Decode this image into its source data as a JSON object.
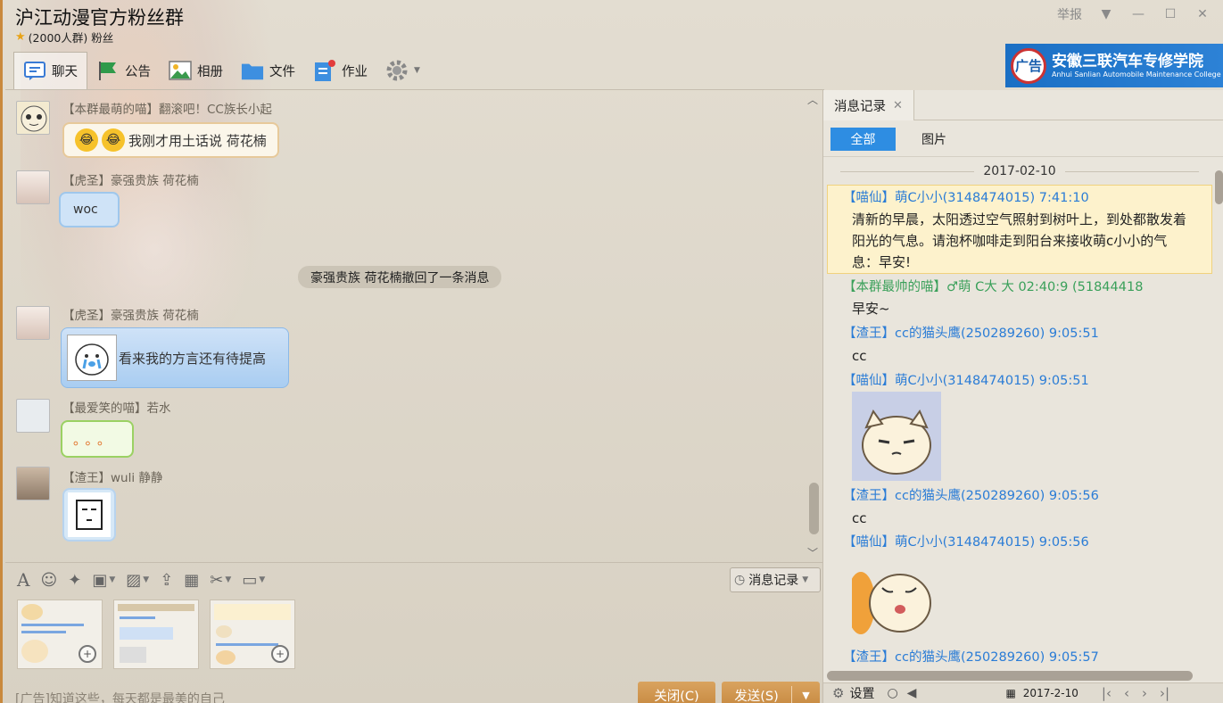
{
  "window": {
    "title": "沪江动漫官方粉丝群",
    "subtitle": "(2000人群) 粉丝",
    "report_label": "举报"
  },
  "ad_banner": {
    "logo_text": "广告",
    "main": "安徽三联汽车专修学院",
    "sub": "Anhui Sanlian Automobile Maintenance College"
  },
  "tabs": [
    {
      "label": "聊天",
      "icon": "chat-icon"
    },
    {
      "label": "公告",
      "icon": "announcement-flag-icon"
    },
    {
      "label": "相册",
      "icon": "photo-album-icon"
    },
    {
      "label": "文件",
      "icon": "folder-icon"
    },
    {
      "label": "作业",
      "icon": "homework-icon"
    }
  ],
  "chat": {
    "messages": [
      {
        "sender": "【本群最萌的喵】翻滚吧！CC族长小起",
        "text": "我刚才用土话说  荷花楠"
      },
      {
        "sender": "【虎圣】豪强贵族 荷花楠",
        "text": "woc"
      },
      {
        "sender": "【虎圣】豪强贵族 荷花楠",
        "text": "看来我的方言还有待提高"
      },
      {
        "sender": "【最爱笑的喵】若水",
        "text": "。。。"
      },
      {
        "sender": "【渣王】wuli 静静",
        "text": ""
      }
    ],
    "system_message": "豪强贵族 荷花楠撤回了一条消息"
  },
  "input": {
    "msg_record_label": "消息记录",
    "ad_text": "[广告]知道这些，每天都是最美的自己",
    "close_label": "关闭(C)",
    "send_label": "发送(S)"
  },
  "history": {
    "tab_label": "消息记录",
    "filter_all": "全部",
    "filter_images": "图片",
    "date": "2017-02-10",
    "entries": [
      {
        "head": "【喵仙】萌C小小(3148474015) 7:41:10",
        "body": "清新的早晨，太阳透过空气照射到树叶上，到处都散发着阳光的气息。请泡杯咖啡走到阳台来接收萌c小小的气息：早安!"
      },
      {
        "head": "【本群最帅的喵】♂萌    C大    大     02:40:9 (51844418",
        "body": "早安~"
      },
      {
        "head": "【渣王】cc的猫头鹰(250289260) 9:05:51",
        "body": "cc"
      },
      {
        "head": "【喵仙】萌C小小(3148474015) 9:05:51",
        "body": ""
      },
      {
        "head": "【渣王】cc的猫头鹰(250289260) 9:05:56",
        "body": "cc"
      },
      {
        "head": "【喵仙】萌C小小(3148474015) 9:05:56",
        "body": ""
      },
      {
        "head": "【渣王】cc的猫头鹰(250289260) 9:05:57",
        "body": ""
      }
    ],
    "footer_settings": "设置",
    "footer_date": "2017-2-10"
  },
  "colors": {
    "accent_blue": "#2e8de2",
    "button_orange": "#c6883f",
    "name_blue": "#2a7cd6",
    "name_green": "#3aa05a"
  }
}
